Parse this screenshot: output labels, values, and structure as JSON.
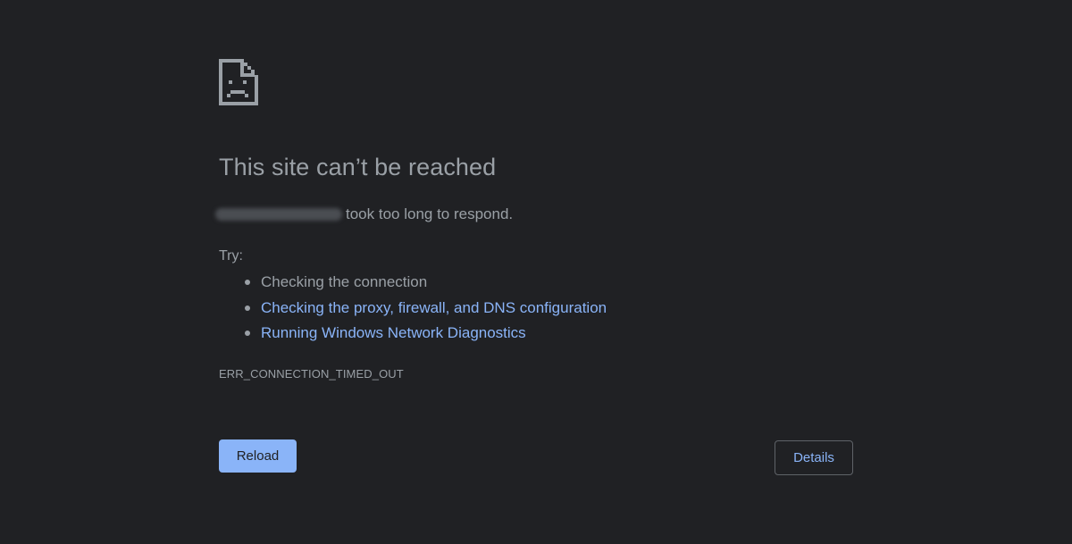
{
  "error": {
    "icon": "sad-document-icon",
    "title": "This site can’t be reached",
    "summary_suffix": "took too long to respond.",
    "try_label": "Try:",
    "suggestions": [
      {
        "text": "Checking the connection",
        "is_link": false
      },
      {
        "text": "Checking the proxy, firewall, and DNS configuration",
        "is_link": true
      },
      {
        "text": "Running Windows Network Diagnostics",
        "is_link": true
      }
    ],
    "code": "ERR_CONNECTION_TIMED_OUT"
  },
  "buttons": {
    "reload": "Reload",
    "details": "Details"
  },
  "colors": {
    "background": "#202124",
    "text": "#9aa0a6",
    "link": "#8ab4f8",
    "primary_button": "#8ab4f8",
    "button_border": "#5f6368"
  }
}
